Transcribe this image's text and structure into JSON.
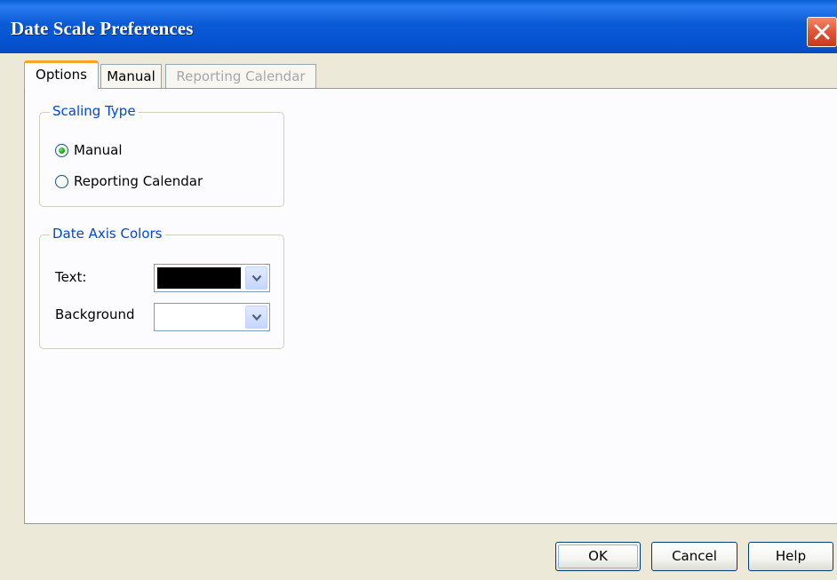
{
  "window": {
    "title": "Date Scale Preferences",
    "title_bar_color": "#0553d0",
    "close_icon": "close-icon"
  },
  "tabs": [
    {
      "label": "Options",
      "selected": true,
      "enabled": true
    },
    {
      "label": "Manual",
      "selected": false,
      "enabled": true
    },
    {
      "label": "Reporting Calendar",
      "selected": false,
      "enabled": false
    }
  ],
  "scaling_type": {
    "legend": "Scaling Type",
    "options": [
      {
        "label": "Manual",
        "checked": true
      },
      {
        "label": "Reporting Calendar",
        "checked": false
      }
    ]
  },
  "date_axis_colors": {
    "legend": "Date Axis Colors",
    "text_label": "Text:",
    "text_color": "#000000",
    "background_label": "Background",
    "background_color": "#ffffff"
  },
  "buttons": {
    "ok": "OK",
    "cancel": "Cancel",
    "help": "Help"
  }
}
